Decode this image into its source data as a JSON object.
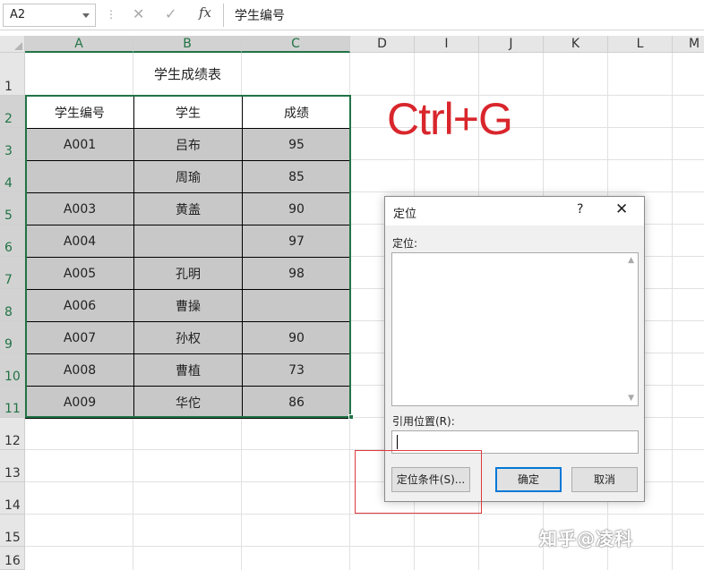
{
  "formula_bar": {
    "name_box": "A2",
    "content": "学生编号"
  },
  "columns": [
    "A",
    "B",
    "C",
    "D",
    "I",
    "J",
    "K",
    "L",
    "M"
  ],
  "rows": [
    "1",
    "2",
    "3",
    "4",
    "5",
    "6",
    "7",
    "8",
    "9",
    "10",
    "11",
    "12",
    "13",
    "14",
    "15",
    "16"
  ],
  "sheet": {
    "title": "学生成绩表",
    "headers": [
      "学生编号",
      "学生",
      "成绩"
    ],
    "data": [
      [
        "A001",
        "吕布",
        "95"
      ],
      [
        "",
        "周瑜",
        "85"
      ],
      [
        "A003",
        "黄盖",
        "90"
      ],
      [
        "A004",
        "",
        "97"
      ],
      [
        "A005",
        "孔明",
        "98"
      ],
      [
        "A006",
        "曹操",
        ""
      ],
      [
        "A007",
        "孙权",
        "90"
      ],
      [
        "A008",
        "曹植",
        "73"
      ],
      [
        "A009",
        "华佗",
        "86"
      ]
    ]
  },
  "annotation": {
    "shortcut_text": "Ctrl+G",
    "color": "#d8262c"
  },
  "dialog": {
    "title": "定位",
    "help": "?",
    "close": "✕",
    "goto_label": "定位:",
    "reference_label": "引用位置(R):",
    "reference_value": "",
    "special_button": "定位条件(S)...",
    "ok_button": "确定",
    "cancel_button": "取消"
  },
  "watermark": "知乎@凌科",
  "colors": {
    "selection": "#217346",
    "filled_cell": "#c8c8c8",
    "highlight_box": "#e0393e",
    "default_button_border": "#0078d7"
  }
}
